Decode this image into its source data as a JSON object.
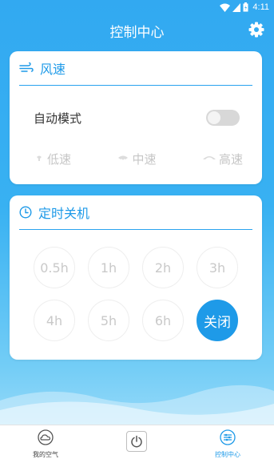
{
  "status_bar": {
    "time": "4:11"
  },
  "header": {
    "title": "控制中心"
  },
  "wind_card": {
    "title": "风速",
    "auto_mode_label": "自动模式",
    "auto_mode_on": false,
    "speeds": [
      {
        "label": "低速",
        "icon": "fan-low-icon"
      },
      {
        "label": "中速",
        "icon": "fan-medium-icon"
      },
      {
        "label": "高速",
        "icon": "fan-high-icon"
      }
    ]
  },
  "timer_card": {
    "title": "定时关机",
    "options": [
      "0.5h",
      "1h",
      "2h",
      "3h",
      "4h",
      "5h",
      "6h",
      "关闭"
    ],
    "selected": "关闭"
  },
  "bottom_nav": {
    "items": [
      {
        "label": "我的空气",
        "icon": "cloud-icon"
      },
      {
        "label": "",
        "icon": "power-icon"
      },
      {
        "label": "控制中心",
        "icon": "sliders-icon"
      }
    ],
    "active_index": 2
  },
  "colors": {
    "accent": "#1e9ae8",
    "background": "#38b1f2",
    "disabled": "#c9c9c9"
  }
}
